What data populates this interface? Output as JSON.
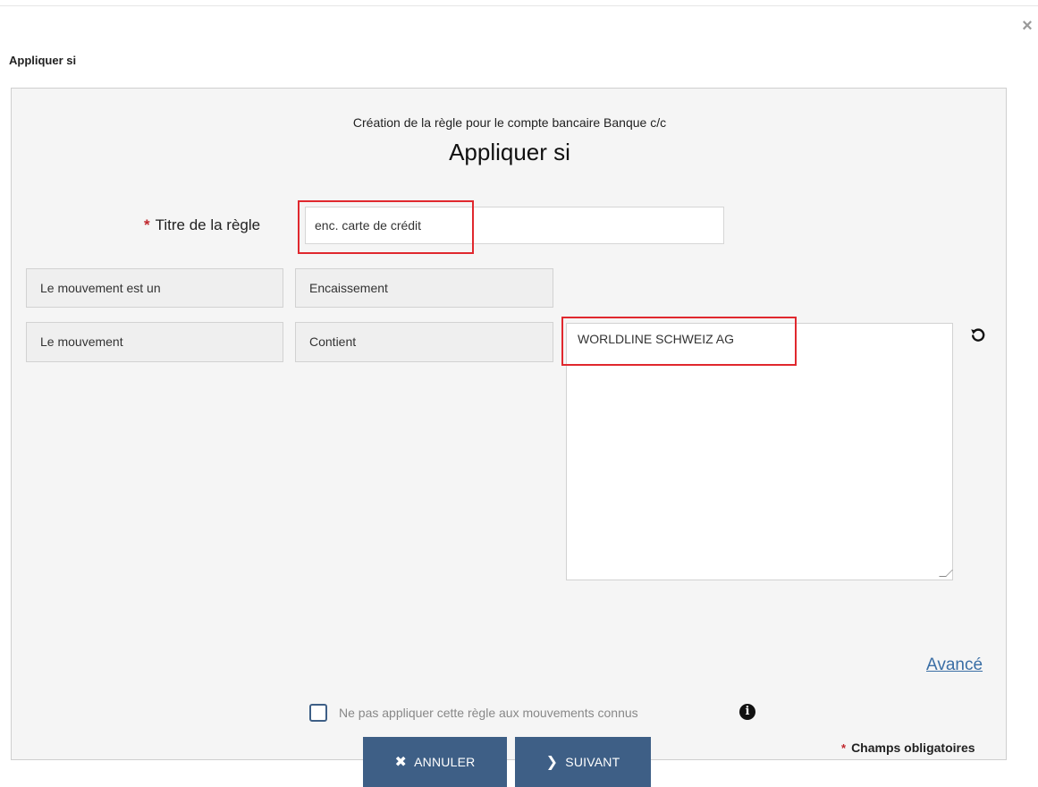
{
  "dialog": {
    "close_icon": "×",
    "heading": "Appliquer si"
  },
  "panel": {
    "subtitle": "Création de la règle pour le compte bancaire Banque c/c",
    "title": "Appliquer si"
  },
  "form": {
    "rule_title_label": "Titre de la règle",
    "required_mark": "*",
    "rule_title_value": "enc. carte de crédit"
  },
  "conditions": [
    {
      "field": "Le mouvement est un",
      "operator": "Encaissement"
    },
    {
      "field": "Le mouvement",
      "operator": "Contient",
      "value": "WORLDLINE SCHWEIZ AG"
    }
  ],
  "advanced_link": "Avancé",
  "known_movements": {
    "label": "Ne pas appliquer cette règle aux mouvements connus",
    "checked": false,
    "info_icon": "i"
  },
  "required_note": {
    "mark": "*",
    "label": "Champs obligatoires"
  },
  "buttons": {
    "cancel_icon": "✖",
    "cancel_label": "ANNULER",
    "next_icon": "❯",
    "next_label": "SUIVANT"
  },
  "colors": {
    "primary_button": "#3e5f86",
    "required_star": "#c0272d",
    "highlight_box": "#e0282e",
    "link": "#3a6ea5"
  }
}
